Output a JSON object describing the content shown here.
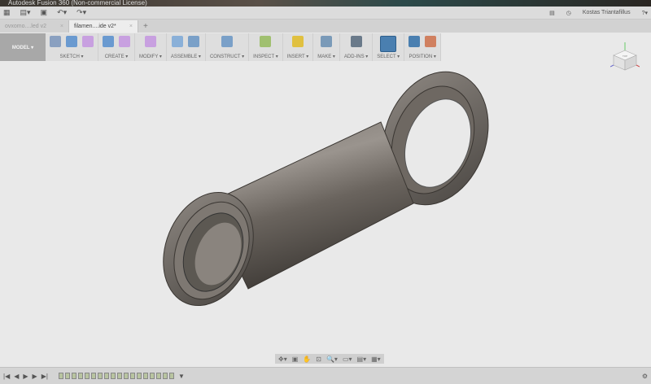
{
  "window": {
    "title": "Autodesk Fusion 360 (Non-commercial License)"
  },
  "quickbar": {
    "user": "Kostas Triantafillus",
    "icons": [
      "grid-icon",
      "file-icon",
      "save-icon",
      "undo-icon",
      "redo-icon",
      "notification-icon",
      "history-icon",
      "help-icon"
    ]
  },
  "tabs": [
    {
      "label": "ovxomo....led v2",
      "active": false
    },
    {
      "label": "filamen....ide v2*",
      "active": true
    }
  ],
  "toolbar": {
    "workspace": "MODEL ▾",
    "groups": [
      {
        "label": "SKETCH ▾",
        "icons": 3
      },
      {
        "label": "CREATE ▾",
        "icons": 2
      },
      {
        "label": "MODIFY ▾",
        "icons": 1
      },
      {
        "label": "ASSEMBLE ▾",
        "icons": 2
      },
      {
        "label": "CONSTRUCT ▾",
        "icons": 1
      },
      {
        "label": "INSPECT ▾",
        "icons": 1
      },
      {
        "label": "INSERT ▾",
        "icons": 1
      },
      {
        "label": "MAKE ▾",
        "icons": 1
      },
      {
        "label": "ADD-INS ▾",
        "icons": 1
      },
      {
        "label": "SELECT ▾",
        "icons": 1
      },
      {
        "label": "POSITION ▾",
        "icons": 2
      }
    ]
  },
  "viewcube": {
    "label": "TOP",
    "axes": [
      "Y",
      "Z",
      "X"
    ]
  },
  "navbar": {
    "items": [
      "orbit",
      "look-at",
      "pan",
      "zoom-window",
      "zoom",
      "display-settings",
      "visual-style",
      "grid-settings"
    ]
  },
  "timeline": {
    "controls": [
      "|◀",
      "◀",
      "▶",
      "▶",
      "▶|"
    ],
    "features": 18
  },
  "colors": {
    "select_active": "#4a7fb0",
    "model_bg": "#a8a8a8"
  }
}
